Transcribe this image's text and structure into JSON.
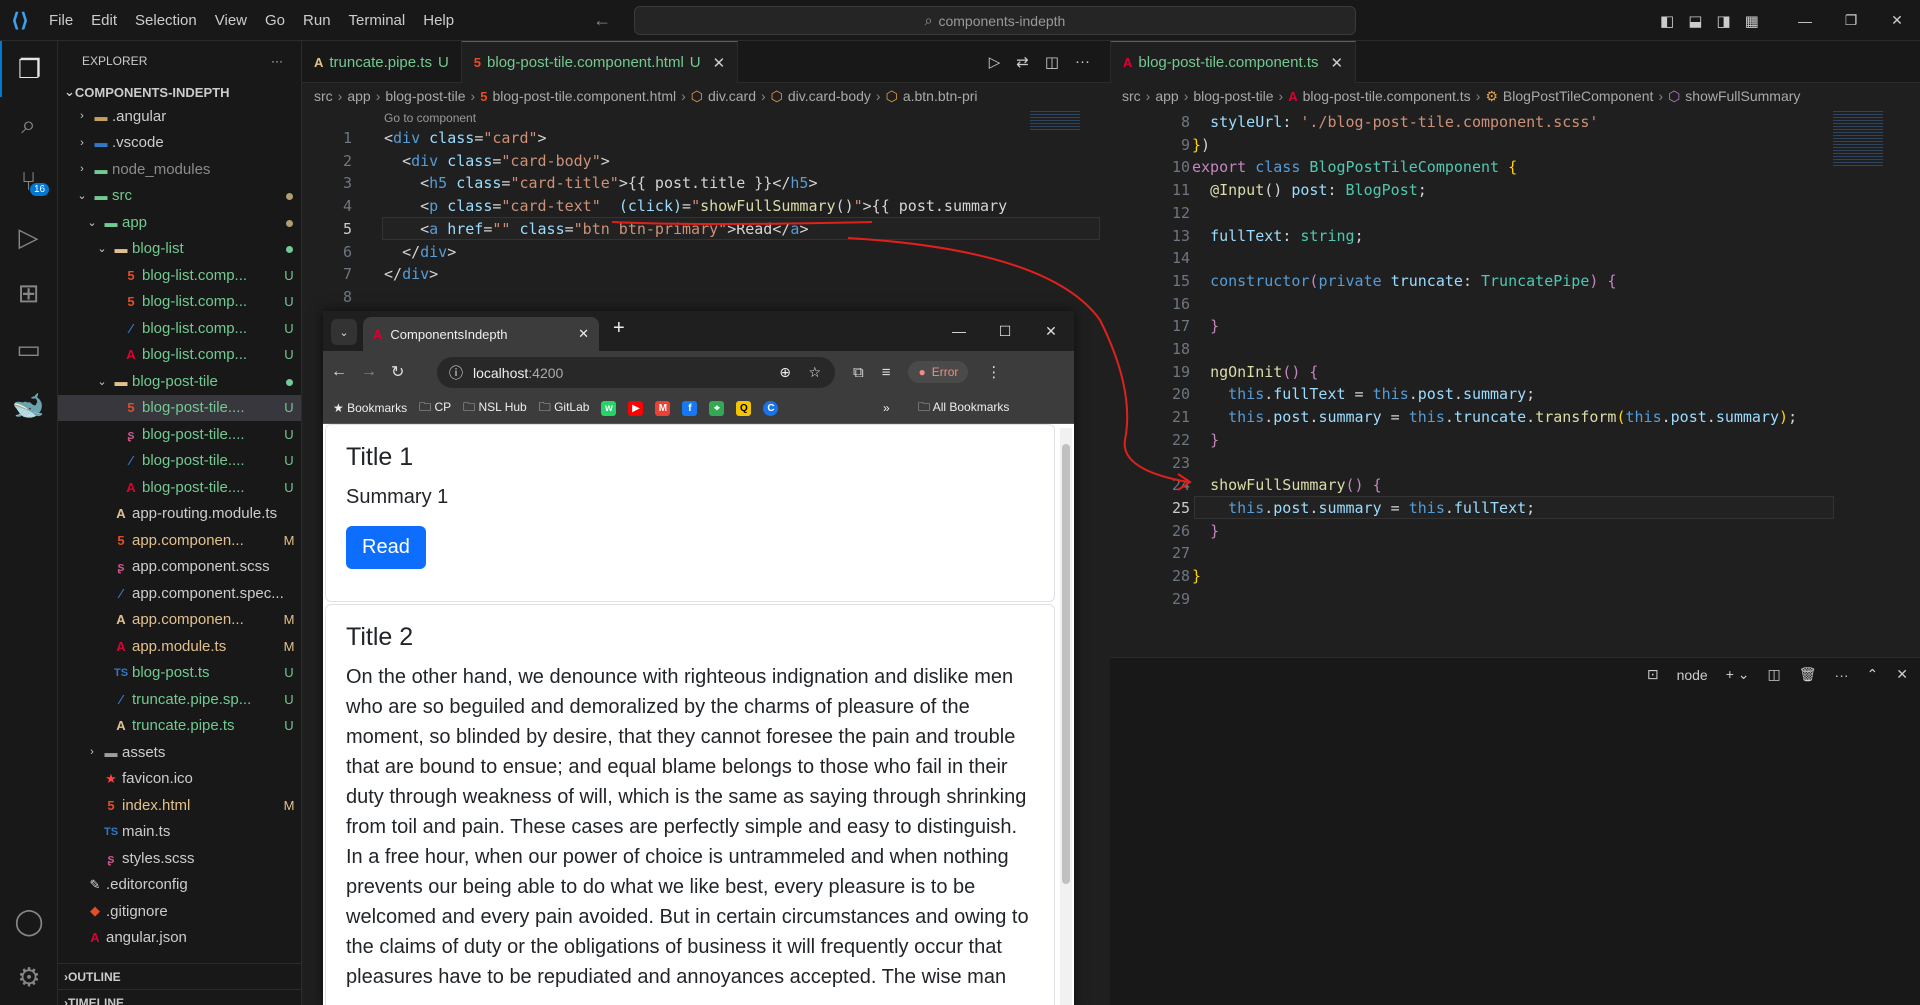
{
  "titlebar": {
    "menu": [
      "File",
      "Edit",
      "Selection",
      "View",
      "Go",
      "Run",
      "Terminal",
      "Help"
    ],
    "search": "components-indepth"
  },
  "activity": {
    "source_control_badge": "16"
  },
  "explorer": {
    "header": "EXPLORER",
    "project": "COMPONENTS-INDEPTH",
    "items": [
      {
        "label": ".angular",
        "status": ""
      },
      {
        "label": ".vscode",
        "status": ""
      },
      {
        "label": "node_modules",
        "status": ""
      },
      {
        "label": "src",
        "status": ""
      },
      {
        "label": "app",
        "status": ""
      },
      {
        "label": "blog-list",
        "status": ""
      },
      {
        "label": "blog-list.comp...",
        "status": "U"
      },
      {
        "label": "blog-list.comp...",
        "status": "U"
      },
      {
        "label": "blog-list.comp...",
        "status": "U"
      },
      {
        "label": "blog-list.comp...",
        "status": "U"
      },
      {
        "label": "blog-post-tile",
        "status": ""
      },
      {
        "label": "blog-post-tile....",
        "status": "U"
      },
      {
        "label": "blog-post-tile....",
        "status": "U"
      },
      {
        "label": "blog-post-tile....",
        "status": "U"
      },
      {
        "label": "blog-post-tile....",
        "status": "U"
      },
      {
        "label": "app-routing.module.ts",
        "status": ""
      },
      {
        "label": "app.componen...",
        "status": "M"
      },
      {
        "label": "app.component.scss",
        "status": ""
      },
      {
        "label": "app.component.spec...",
        "status": ""
      },
      {
        "label": "app.componen...",
        "status": "M"
      },
      {
        "label": "app.module.ts",
        "status": "M"
      },
      {
        "label": "blog-post.ts",
        "status": "U"
      },
      {
        "label": "truncate.pipe.sp...",
        "status": "U"
      },
      {
        "label": "truncate.pipe.ts",
        "status": "U"
      },
      {
        "label": "assets",
        "status": ""
      },
      {
        "label": "favicon.ico",
        "status": ""
      },
      {
        "label": "index.html",
        "status": "M"
      },
      {
        "label": "main.ts",
        "status": ""
      },
      {
        "label": "styles.scss",
        "status": ""
      },
      {
        "label": ".editorconfig",
        "status": ""
      },
      {
        "label": ".gitignore",
        "status": ""
      },
      {
        "label": "angular.json",
        "status": ""
      }
    ],
    "outline": "OUTLINE",
    "timeline": "TIMELINE"
  },
  "left_editor": {
    "tabs": [
      {
        "label": "truncate.pipe.ts",
        "status": "U"
      },
      {
        "label": "blog-post-tile.component.html",
        "status": "U"
      }
    ],
    "breadcrumbs": [
      "src",
      "app",
      "blog-post-tile",
      "blog-post-tile.component.html",
      "div.card",
      "div.card-body",
      "a.btn.btn-pri"
    ],
    "codelens": "Go to component",
    "line_numbers": [
      "1",
      "2",
      "3",
      "4",
      "5",
      "6",
      "7",
      "8"
    ]
  },
  "right_editor": {
    "tab": "blog-post-tile.component.ts",
    "breadcrumbs": [
      "src",
      "app",
      "blog-post-tile",
      "blog-post-tile.component.ts",
      "BlogPostTileComponent",
      "showFullSummary"
    ],
    "line_numbers": [
      "8",
      "9",
      "10",
      "11",
      "12",
      "13",
      "14",
      "15",
      "16",
      "17",
      "18",
      "19",
      "20",
      "21",
      "22",
      "23",
      "24",
      "25",
      "26",
      "27",
      "28",
      "29"
    ]
  },
  "panel": {
    "terminal": "node"
  },
  "browser": {
    "tab_title": "ComponentsIndepth",
    "url_host": "localhost",
    "url_port": ":4200",
    "error_label": "Error",
    "bookmarks": [
      "Bookmarks",
      "CP",
      "NSL Hub",
      "GitLab"
    ],
    "all_bookmarks": "All Bookmarks",
    "cards": [
      {
        "title": "Title 1",
        "summary": "Summary 1",
        "button": "Read"
      },
      {
        "title": "Title 2",
        "summary": "On the other hand, we denounce with righteous indignation and dislike men who are so beguiled and demoralized by the charms of pleasure of the moment, so blinded by desire, that they cannot foresee the pain and trouble that are bound to ensue; and equal blame belongs to those who fail in their duty through weakness of will, which is the same as saying through shrinking from toil and pain. These cases are perfectly simple and easy to distinguish. In a free hour, when our power of choice is untrammeled and when nothing prevents our being able to do what we like best, every pleasure is to be welcomed and every pain avoided. But in certain circumstances and owing to the claims of duty or the obligations of business it will frequently occur that pleasures have to be repudiated and annoyances accepted. The wise man"
      }
    ]
  },
  "colors": {
    "accent": "#0078d4",
    "annotation": "#e0201b",
    "primary_button": "#0d6efd"
  }
}
